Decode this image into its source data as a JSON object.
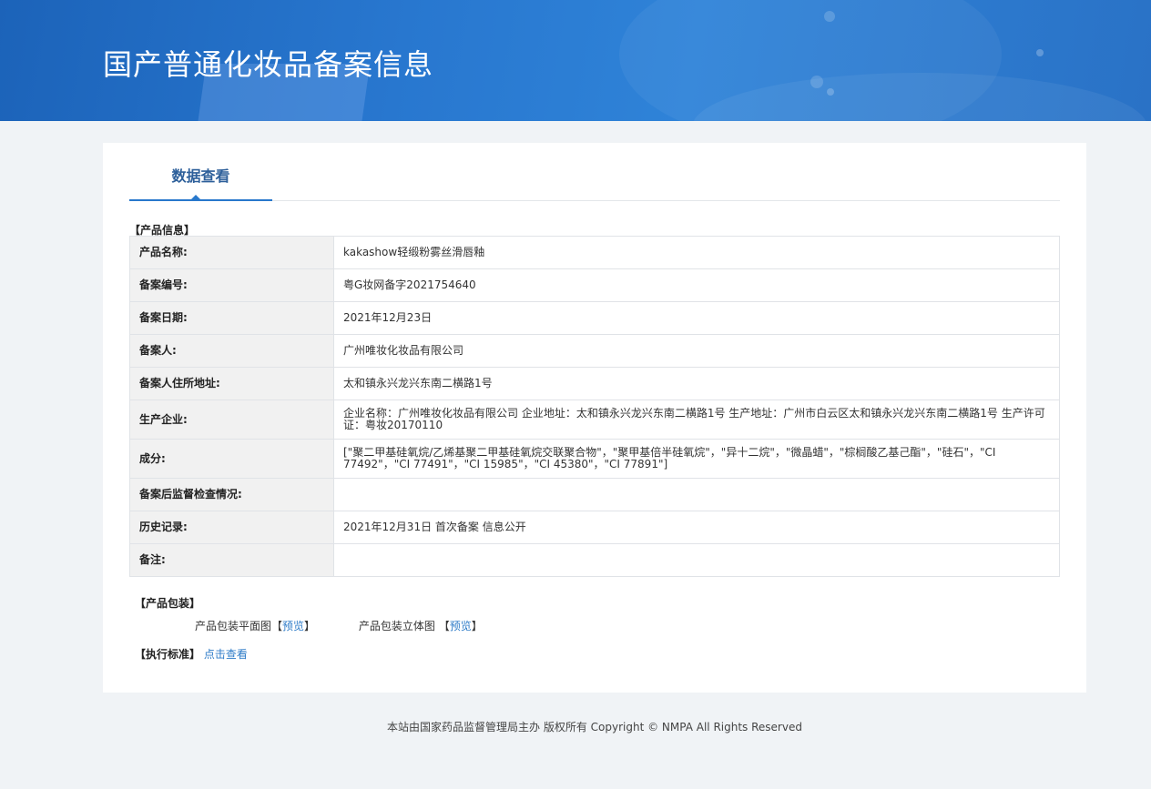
{
  "header": {
    "title": "国产普通化妆品备案信息"
  },
  "tabs": [
    {
      "label": "数据查看",
      "active": true
    }
  ],
  "product_info": {
    "section_title": "【产品信息】",
    "rows": [
      {
        "label": "产品名称:",
        "value": "kakashow轻缎粉雾丝滑唇釉"
      },
      {
        "label": "备案编号:",
        "value": "粤G妆网备字2021754640"
      },
      {
        "label": "备案日期:",
        "value": "2021年12月23日"
      },
      {
        "label": "备案人:",
        "value": "广州唯妆化妆品有限公司"
      },
      {
        "label": "备案人住所地址:",
        "value": "太和镇永兴龙兴东南二横路1号"
      },
      {
        "label": "生产企业:",
        "value": "企业名称：广州唯妆化妆品有限公司 企业地址：太和镇永兴龙兴东南二横路1号 生产地址：广州市白云区太和镇永兴龙兴东南二横路1号 生产许可证：粤妆20170110"
      },
      {
        "label": "成分:",
        "value": "[\"聚二甲基硅氧烷/乙烯基聚二甲基硅氧烷交联聚合物\"，\"聚甲基倍半硅氧烷\"，\"异十二烷\"，\"微晶蜡\"，\"棕榈酸乙基己酯\"，\"硅石\"，\"CI 77492\"，\"CI 77491\"，\"CI 15985\"，\"CI 45380\"，\"CI 77891\"]"
      },
      {
        "label": "备案后监督检查情况:",
        "value": ""
      },
      {
        "label": "历史记录:",
        "value": "2021年12月31日 首次备案 信息公开"
      },
      {
        "label": "备注:",
        "value": ""
      }
    ]
  },
  "packaging": {
    "section_title": "【产品包装】",
    "flat_label": "产品包装平面图",
    "flat_open": "【",
    "flat_link": "预览",
    "flat_close": "】",
    "stereo_label": "产品包装立体图",
    "stereo_open": "【",
    "stereo_link": "预览",
    "stereo_close": "】"
  },
  "standard": {
    "section_title": "【执行标准】",
    "link": "点击查看"
  },
  "footer": {
    "text": "本站由国家药品监督管理局主办 版权所有 Copyright © NMPA All Rights Reserved"
  },
  "colors": {
    "banner": "#2877cf",
    "accent": "#2878cc",
    "link": "#2f7cc8",
    "label_bg": "#f1f1f1"
  }
}
